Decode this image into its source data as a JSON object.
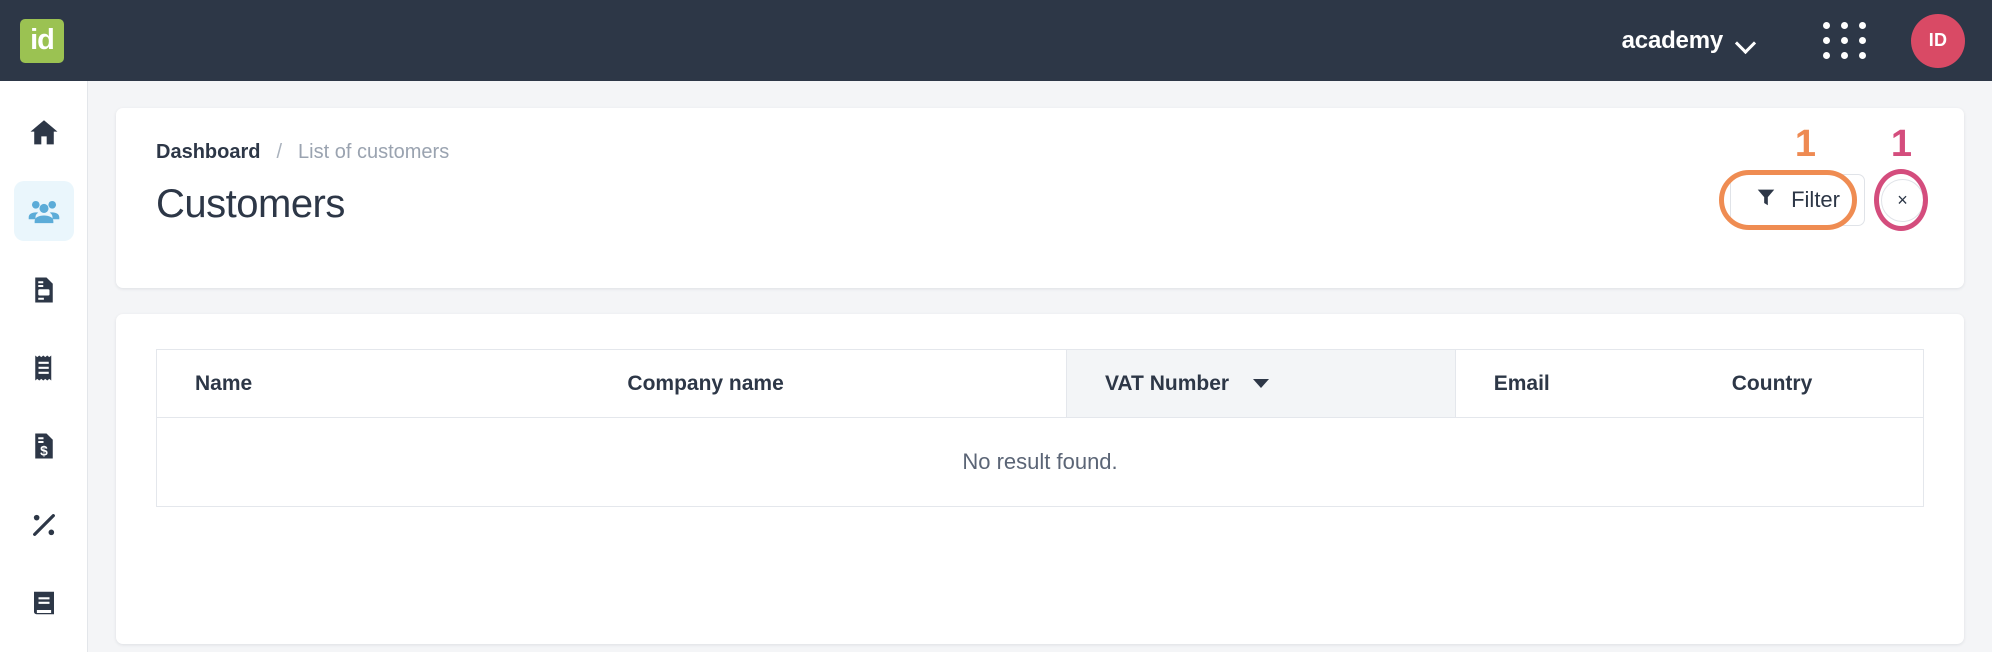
{
  "topbar": {
    "logo_text": "id",
    "org_name": "academy",
    "org_chevron_icon": "chevron-down-icon",
    "apps_icon": "apps-grid-icon",
    "avatar_initials": "ID",
    "background_color": "#2d3747",
    "logo_color": "#9bc252",
    "avatar_color": "#d94a65"
  },
  "sidebar": {
    "items": [
      {
        "icon": "home-icon",
        "label": "Home",
        "active": false
      },
      {
        "icon": "users-icon",
        "label": "Customers",
        "active": true
      },
      {
        "icon": "document-icon",
        "label": "Quotes",
        "active": false
      },
      {
        "icon": "receipt-icon",
        "label": "Receipts",
        "active": false
      },
      {
        "icon": "invoice-dollar-icon",
        "label": "Invoices",
        "active": false
      },
      {
        "icon": "percent-icon",
        "label": "Taxes",
        "active": false
      },
      {
        "icon": "book-icon",
        "label": "Ledger",
        "active": false
      }
    ],
    "active_color": "#5cacd8",
    "active_background": "#eaf6fc",
    "icon_color": "#2d3747"
  },
  "breadcrumb": {
    "root": "Dashboard",
    "separator": "/",
    "current": "List of customers"
  },
  "page": {
    "title": "Customers"
  },
  "actions": {
    "filter_label": "Filter",
    "filter_icon": "funnel-icon",
    "close_label": "×",
    "close_icon": "close-icon"
  },
  "annotations": [
    {
      "number": "1",
      "color": "#ee8a52",
      "target": "filter-button",
      "shape": "rounded-rect"
    },
    {
      "number": "1",
      "color": "#d44d7d",
      "target": "close-button",
      "shape": "circle"
    }
  ],
  "table": {
    "columns": [
      {
        "label": "Name",
        "sorted": false
      },
      {
        "label": "Company name",
        "sorted": false
      },
      {
        "label": "VAT Number",
        "sorted": true,
        "sort_icon": "caret-down-icon"
      },
      {
        "label": "Email",
        "sorted": false
      },
      {
        "label": "Country",
        "sorted": false
      }
    ],
    "empty_message": "No result found.",
    "rows": []
  }
}
